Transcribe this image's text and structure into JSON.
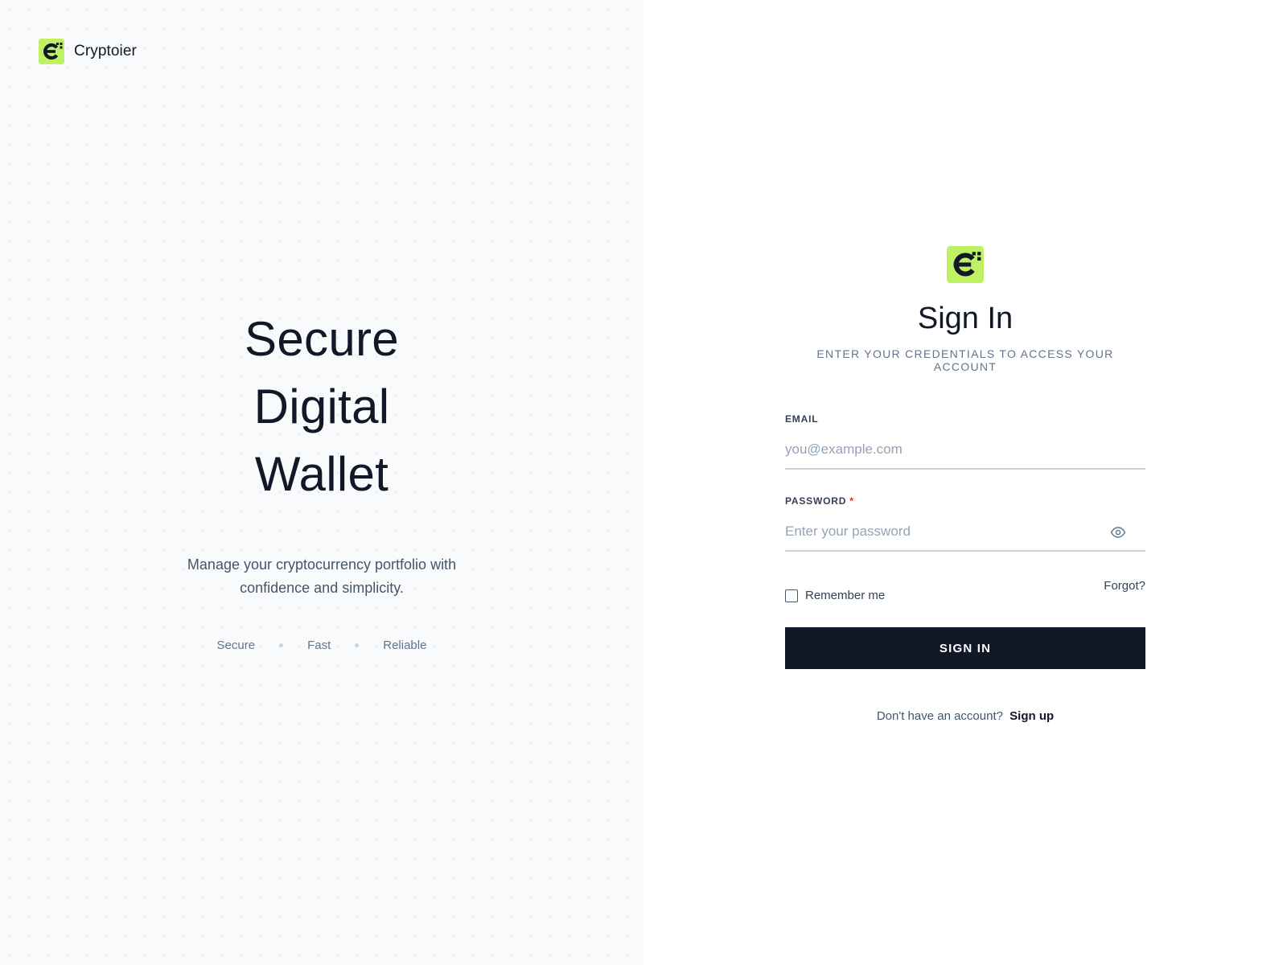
{
  "brand": {
    "name": "Cryptoier",
    "logo_icon": "crypto-c-logo-icon",
    "accent_color": "#bef264"
  },
  "hero": {
    "lines": [
      "Secure",
      "Digital",
      "Wallet"
    ],
    "subtitle": "Manage your cryptocurrency portfolio with confidence and simplicity.",
    "features": [
      "Secure",
      "Fast",
      "Reliable"
    ]
  },
  "form": {
    "title": "Sign In",
    "subtitle": "ENTER YOUR CREDENTIALS TO ACCESS YOUR ACCOUNT",
    "email": {
      "label": "EMAIL",
      "value": "",
      "placeholder": "you@example.com"
    },
    "password": {
      "label": "PASSWORD",
      "required_mark": "*",
      "value": "",
      "placeholder": "Enter your password",
      "toggle_icon": "eye-icon"
    },
    "remember_label": "Remember me",
    "remember_checked": false,
    "forgot_label": "Forgot?",
    "submit_label": "SIGN IN",
    "signup_prompt": "Don't have an account?",
    "signup_link": "Sign up"
  },
  "colors": {
    "primary_dark": "#111827",
    "required": "#dc2626",
    "left_panel_bg": "#f8fafc"
  }
}
